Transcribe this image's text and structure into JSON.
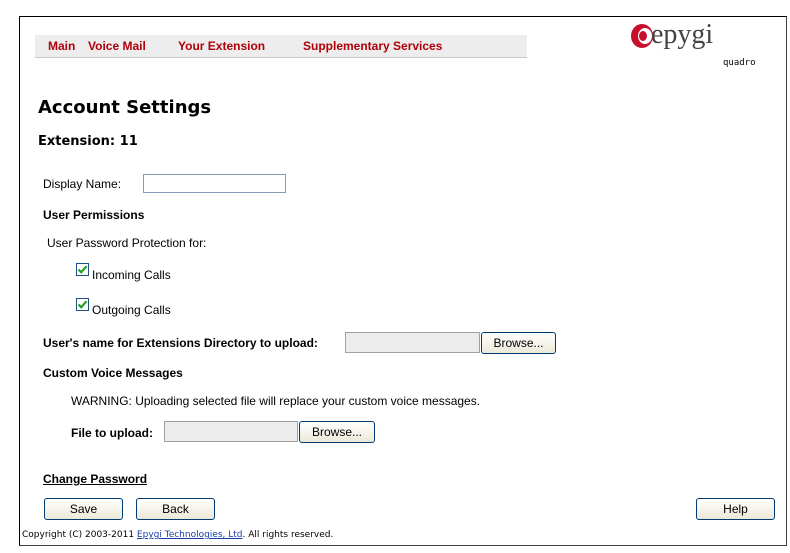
{
  "nav": {
    "items": [
      {
        "label": "Main"
      },
      {
        "label": "Voice Mail"
      },
      {
        "label": "Your Extension"
      },
      {
        "label": "Supplementary Services"
      }
    ]
  },
  "logo": {
    "word": "epygi",
    "sub": "quadro"
  },
  "page": {
    "title": "Account Settings",
    "extension": "Extension: 11"
  },
  "form": {
    "display_name_label": "Display Name:",
    "display_name_value": "",
    "user_permissions_heading": "User Permissions",
    "password_protection_label": "User Password Protection for:",
    "incoming_calls_label": "Incoming Calls",
    "incoming_calls_checked": true,
    "outgoing_calls_label": "Outgoing Calls",
    "outgoing_calls_checked": true,
    "directory_upload_label": "User's name for Extensions Directory to upload:",
    "browse_label": "Browse...",
    "custom_voice_heading": "Custom Voice Messages",
    "warning_text": "WARNING: Uploading selected file will replace your custom voice messages.",
    "file_upload_label": "File to upload:",
    "change_password_link": "Change Password"
  },
  "buttons": {
    "save": "Save",
    "back": "Back",
    "help": "Help"
  },
  "footer": {
    "prefix": "Copyright (C) 2003-2011 ",
    "company_link": "Epygi Technologies, Ltd",
    "suffix": ". All rights reserved."
  },
  "colors": {
    "nav_link": "#b0000a",
    "logo_red": "#c8102e",
    "checkmark": "#21a121"
  }
}
